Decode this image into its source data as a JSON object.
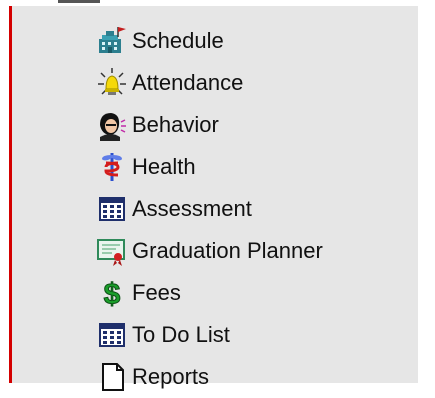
{
  "colors": {
    "border_accent": "#d40000",
    "panel_background": "#e6e6e6",
    "text": "#111111"
  },
  "menu": {
    "items": [
      {
        "label": "Schedule",
        "icon": "schedule-icon"
      },
      {
        "label": "Attendance",
        "icon": "attendance-icon"
      },
      {
        "label": "Behavior",
        "icon": "behavior-icon"
      },
      {
        "label": "Health",
        "icon": "health-icon"
      },
      {
        "label": "Assessment",
        "icon": "assessment-icon"
      },
      {
        "label": "Graduation Planner",
        "icon": "graduation-planner-icon"
      },
      {
        "label": "Fees",
        "icon": "fees-icon"
      },
      {
        "label": "To Do List",
        "icon": "to-do-list-icon"
      },
      {
        "label": "Reports",
        "icon": "reports-icon"
      }
    ]
  }
}
